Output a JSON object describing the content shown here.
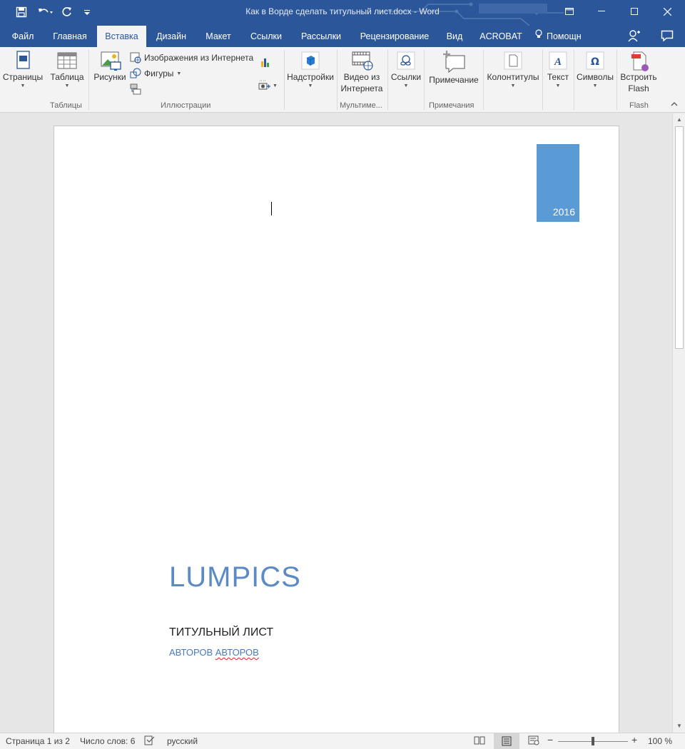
{
  "window": {
    "title": "Как в Ворде сделать титульный лист.docx - Word",
    "minimize_icon": "minimize-icon",
    "maximize_icon": "maximize-icon",
    "close_icon": "close-icon"
  },
  "quick_access": {
    "save_icon": "save-icon",
    "undo_icon": "undo-icon",
    "redo_icon": "redo-icon",
    "customize_icon": "customize-icon"
  },
  "tabs": [
    {
      "label": "Файл",
      "active": false
    },
    {
      "label": "Главная",
      "active": false
    },
    {
      "label": "Вставка",
      "active": true
    },
    {
      "label": "Дизайн",
      "active": false
    },
    {
      "label": "Макет",
      "active": false
    },
    {
      "label": "Ссылки",
      "active": false
    },
    {
      "label": "Рассылки",
      "active": false
    },
    {
      "label": "Рецензирование",
      "active": false
    },
    {
      "label": "Вид",
      "active": false
    },
    {
      "label": "ACROBAT",
      "active": false
    }
  ],
  "tell_me": "Помощн",
  "ribbon": {
    "pages": "Страницы",
    "table": "Таблица",
    "tables_group": "Таблицы",
    "pictures": "Рисунки",
    "online_pictures": "Изображения из Интернета",
    "shapes": "Фигуры",
    "illustrations_group": "Иллюстрации",
    "addins": "Надстройки",
    "online_video_line1": "Видео из",
    "online_video_line2": "Интернета",
    "multimedia_group": "Мультиме...",
    "links": "Ссылки",
    "comment": "Примечание",
    "comments_group": "Примечания",
    "header_footer": "Колонтитулы",
    "text": "Текст",
    "symbols": "Символы",
    "embed_flash_line1": "Встроить",
    "embed_flash_line2": "Flash",
    "flash_group": "Flash"
  },
  "document": {
    "year": "2016",
    "title": "LUMPICS",
    "subtitle": "ТИТУЛЬНЫЙ ЛИСТ",
    "author_word1": "АВТОРОВ",
    "author_word2": "АВТОРОВ"
  },
  "status": {
    "page": "Страница 1 из 2",
    "words": "Число слов: 6",
    "language": "русский",
    "zoom": "100 %",
    "zoom_percent": 100
  },
  "colors": {
    "brand": "#2b579a",
    "accent": "#5b9bd5"
  }
}
